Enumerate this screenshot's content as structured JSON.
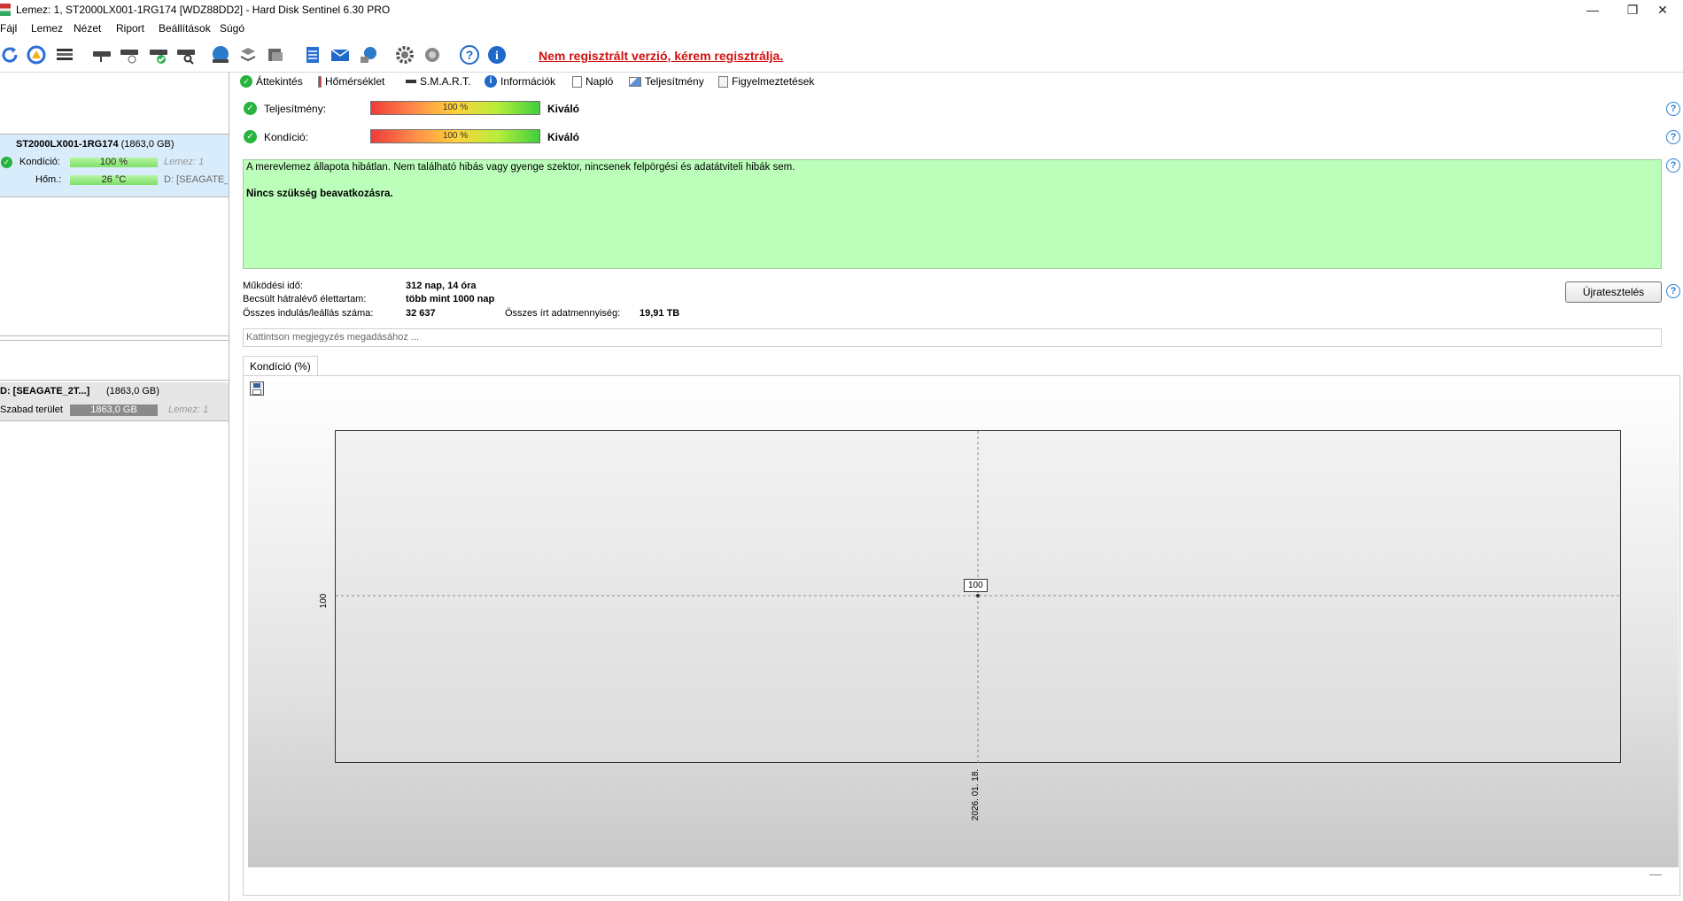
{
  "window": {
    "title": "Lemez: 1, ST2000LX001-1RG174 [WDZ88DD2]  -  Hard Disk Sentinel 6.30 PRO",
    "minimize": "—",
    "restore": "❐",
    "close": "✕"
  },
  "menu": [
    "Fájl",
    "Lemez",
    "Nézet",
    "Riport",
    "Beállítások",
    "Súgó"
  ],
  "toolbar": {
    "registration_message": "Nem regisztrált verzió, kérem regisztrálja.",
    "icons": [
      "refresh-icon",
      "refresh-warning-icon",
      "disk-list-icon",
      "disk-icon",
      "disk-clock-icon",
      "disk-check-icon",
      "disk-search-icon",
      "globe-icon",
      "network-disk-icon",
      "drive-icon",
      "notepad-icon",
      "mail-icon",
      "network-icon",
      "gear-icon",
      "gear-alt-icon",
      "help-icon",
      "info-icon"
    ]
  },
  "left_panel": {
    "disk": {
      "name": "ST2000LX001-1RG174",
      "size": "(1863,0 GB)",
      "health_label": "Kondíció:",
      "health_value": "100 %",
      "health_percent": 100,
      "temp_label": "Hőm.:",
      "temp_value": "26 °C",
      "disk_ref": "Lemez: 1",
      "partition_ref": "D: [SEAGATE_"
    },
    "partition": {
      "name": "D: [SEAGATE_2T...]",
      "size": "(1863,0 GB)",
      "free_label": "Szabad terület",
      "free_value": "1863,0 GB",
      "disk_ref": "Lemez: 1"
    }
  },
  "tabs": [
    "Áttekintés",
    "Hőmérséklet",
    "S.M.A.R.T.",
    "Információk",
    "Napló",
    "Teljesítmény",
    "Figyelmeztetések"
  ],
  "overview": {
    "performance_label": "Teljesítmény:",
    "performance_value": "100 %",
    "performance_percent": 100,
    "performance_rating": "Kiváló",
    "health_label": "Kondíció:",
    "health_value": "100 %",
    "health_percent": 100,
    "health_rating": "Kiváló",
    "status_text": "A merevlemez állapota hibátlan. Nem található hibás vagy gyenge szektor, nincsenek felpörgési és adatátviteli hibák sem.",
    "status_action": "Nincs szükség beavatkozásra.",
    "power_on_label": "Működési idő:",
    "power_on_value": "312 nap, 14 óra",
    "lifetime_label": "Becsült hátralévő élettartam:",
    "lifetime_value": "több mint 1000 nap",
    "startstop_label": "Összes indulás/leállás száma:",
    "startstop_value": "32 637",
    "written_label": "Összes írt adatmennyiség:",
    "written_value": "19,91 TB",
    "retest_button": "Újratesztelés",
    "note_placeholder": "Kattintson megjegyzés megadásához ...",
    "help": "?"
  },
  "chart_tab": "Kondíció  (%)",
  "chart_data": {
    "type": "line",
    "x": [
      "2026. 01. 18."
    ],
    "series": [
      {
        "values": [
          100
        ]
      }
    ],
    "y_tick": "100",
    "point_label": "100",
    "grid": true
  }
}
